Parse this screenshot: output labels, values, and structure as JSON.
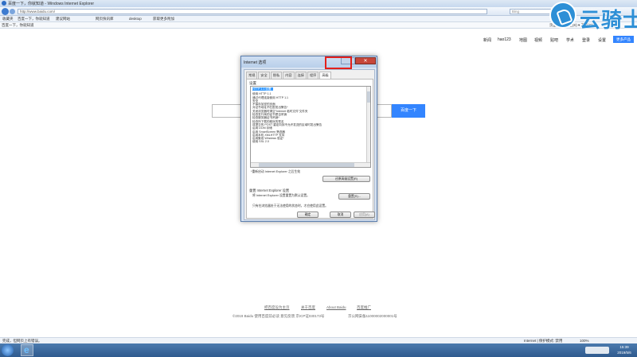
{
  "window": {
    "title": "百度一下，你就知道 - Windows Internet Explorer"
  },
  "navbar": {
    "address": "http://www.baidu.com/",
    "search_placeholder": "Bing"
  },
  "favorites": {
    "label": "收藏夹",
    "items": [
      "百度一下，你就知道",
      "建议网站",
      "网页快讯库",
      "desktop",
      "获取更多附加"
    ]
  },
  "tabbar": {
    "tab_label": "百度一下，你就知道",
    "commands": "页面(P) ▾  安全(S) ▾  工具(O) ▾"
  },
  "logo": {
    "text": "云骑士"
  },
  "baidu": {
    "nav": [
      "新闻",
      "hao123",
      "地图",
      "视频",
      "贴吧",
      "学术",
      "登录",
      "设置"
    ],
    "more": "更多产品",
    "search_button": "百度一下",
    "footer_links": [
      "把百度设为主页",
      "关于百度",
      "About Baidu",
      "百度推广"
    ],
    "footer_copyright": "©2019 Baidu 使用百度前必读 意见反馈 京ICP证030173号",
    "footer_police": "京公网安备11000002000001号"
  },
  "dialog": {
    "title": "Internet 选项",
    "close": "✕",
    "tabs": [
      "常规",
      "安全",
      "隐私",
      "内容",
      "连接",
      "程序",
      "高级"
    ],
    "active_tab": "高级",
    "settings_label": "设置",
    "tree_items": [
      "HTTP 1.1 设置",
      "使用 HTTP 1.1",
      "通过代理连接使用 HTTP 1.1",
      "安全",
      "不保存加密的页面",
      "对证书地址不匹配发出警告*",
      "关闭浏览器时清空“Internet 临时文件”文件夹",
      "检查发行商的证书是否吊销",
      "检查服务器证书吊销*",
      "检查所下载的程序的签名",
      "将提交的 POST 重定向到不允许发送的区域时发出警告",
      "启用 DOM 存储",
      "启用 SmartScreen 筛选器",
      "启用本机 XMLHTTP 支持",
      "启用集成 Windows 验证*",
      "使用 SSL 2.0"
    ],
    "restart_note": "*重新启动 Internet Explorer 之后生效",
    "restore_button": "还原高级设置(R)",
    "reset_section": "重置 Internet Explorer 设置",
    "reset_desc": "将 Internet Explorer 设置重置为默认设置。",
    "reset_button": "重置(S)...",
    "reset_warning": "只有在浏览器处于无法使用的状态时，才应使用此设置。",
    "ok": "确定",
    "cancel": "取消",
    "apply": "应用(A)"
  },
  "statusbar": {
    "left": "完成，但网页上有错误。",
    "zone": "Internet | 保护模式: 禁用",
    "zoom": "100%"
  },
  "taskbar": {
    "time": "15:39",
    "date": "2019/5/6"
  }
}
